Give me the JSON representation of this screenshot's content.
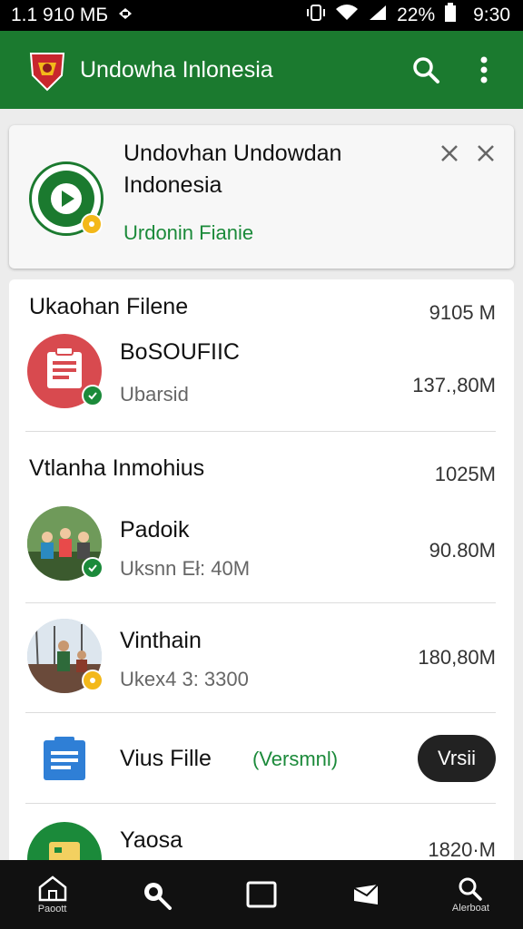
{
  "status_bar": {
    "left_text": "1.1 910 МБ",
    "battery": "22%",
    "time": "9:30"
  },
  "app_bar": {
    "title": "Undowha Inlonesia"
  },
  "top_card": {
    "title": "Undovhan Undowdan Indonesia",
    "subtitle": "Urdonin Fianie"
  },
  "list": {
    "section1": {
      "title": "Ukaohan Filene",
      "size": "9105 M"
    },
    "item1": {
      "title": "BoSOUFIIC",
      "subtitle": "Ubarsid",
      "size": "137.,80M"
    },
    "section2": {
      "title": "Vtlanha Inmohius",
      "size": "1025M"
    },
    "item2": {
      "title": "Padoik",
      "subtitle": "Uksnn Eł: 40M",
      "size": "90.80M"
    },
    "item3": {
      "title": "Vinthain",
      "subtitle": "Ukex4 3: 3300",
      "size": "180,80M"
    },
    "item4": {
      "title": "Vius Fille",
      "tag": "(Versmnl)",
      "button": "Vrsii"
    },
    "item5": {
      "title": "Yaosa",
      "size": "1820·M"
    }
  },
  "bottom_nav": {
    "items": [
      {
        "label": "Paoott",
        "icon": "home-icon"
      },
      {
        "label": "",
        "icon": "search-people-icon"
      },
      {
        "label": "",
        "icon": "square-icon"
      },
      {
        "label": "",
        "icon": "mail-icon"
      },
      {
        "label": "Alerboat",
        "icon": "search-icon"
      }
    ]
  },
  "colors": {
    "primary": "#1b7a2f",
    "accent_green": "#1b8a3a",
    "badge_gold": "#f3b81a",
    "red_icon": "#d84a4f",
    "blue_icon": "#2f7fd6"
  }
}
